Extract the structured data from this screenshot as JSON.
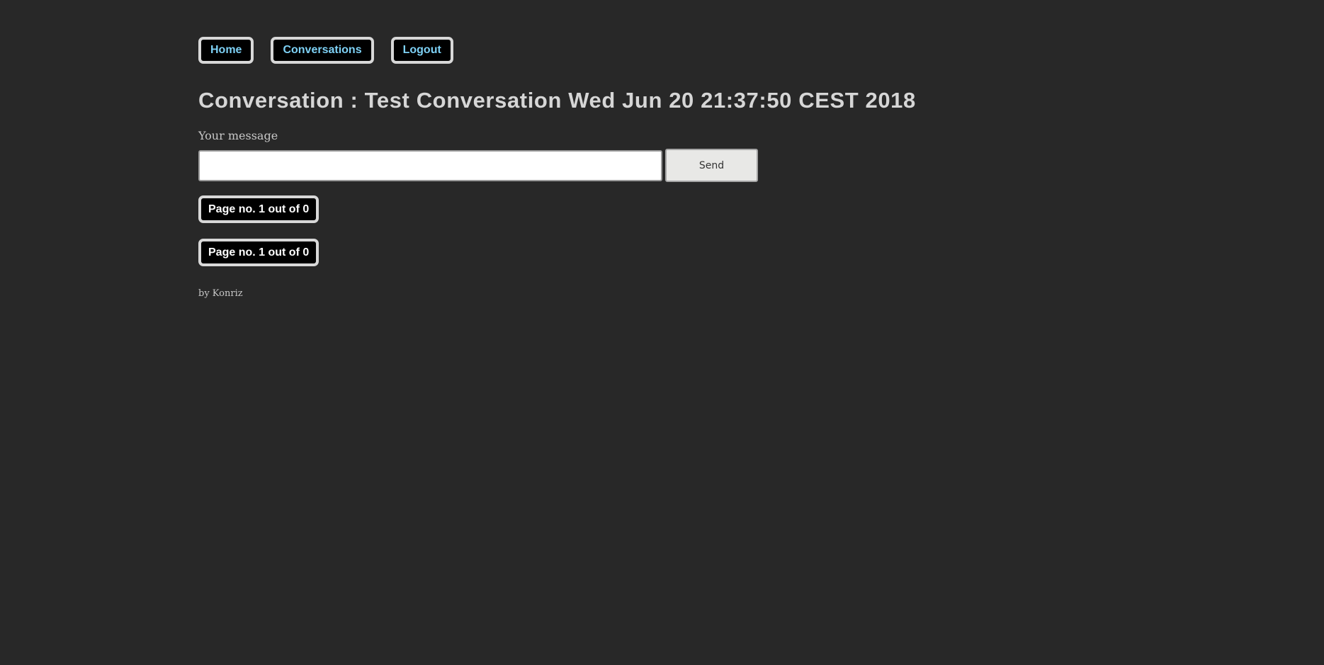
{
  "nav": {
    "home": "Home",
    "conversations": "Conversations",
    "logout": "Logout"
  },
  "page_title": "Conversation : Test Conversation Wed Jun 20 21:37:50 CEST 2018",
  "form": {
    "message_label": "Your message",
    "message_value": "",
    "send_label": "Send"
  },
  "pagination": {
    "top_label": "Page no. 1 out of 0",
    "bottom_label": "Page no. 1 out of 0"
  },
  "footer": {
    "credit": "by Konriz"
  },
  "colors": {
    "background": "#282828",
    "nav_link_text": "#7ed1f5",
    "title_text": "#d6d6d6",
    "button_border": "#d8d8d8"
  }
}
